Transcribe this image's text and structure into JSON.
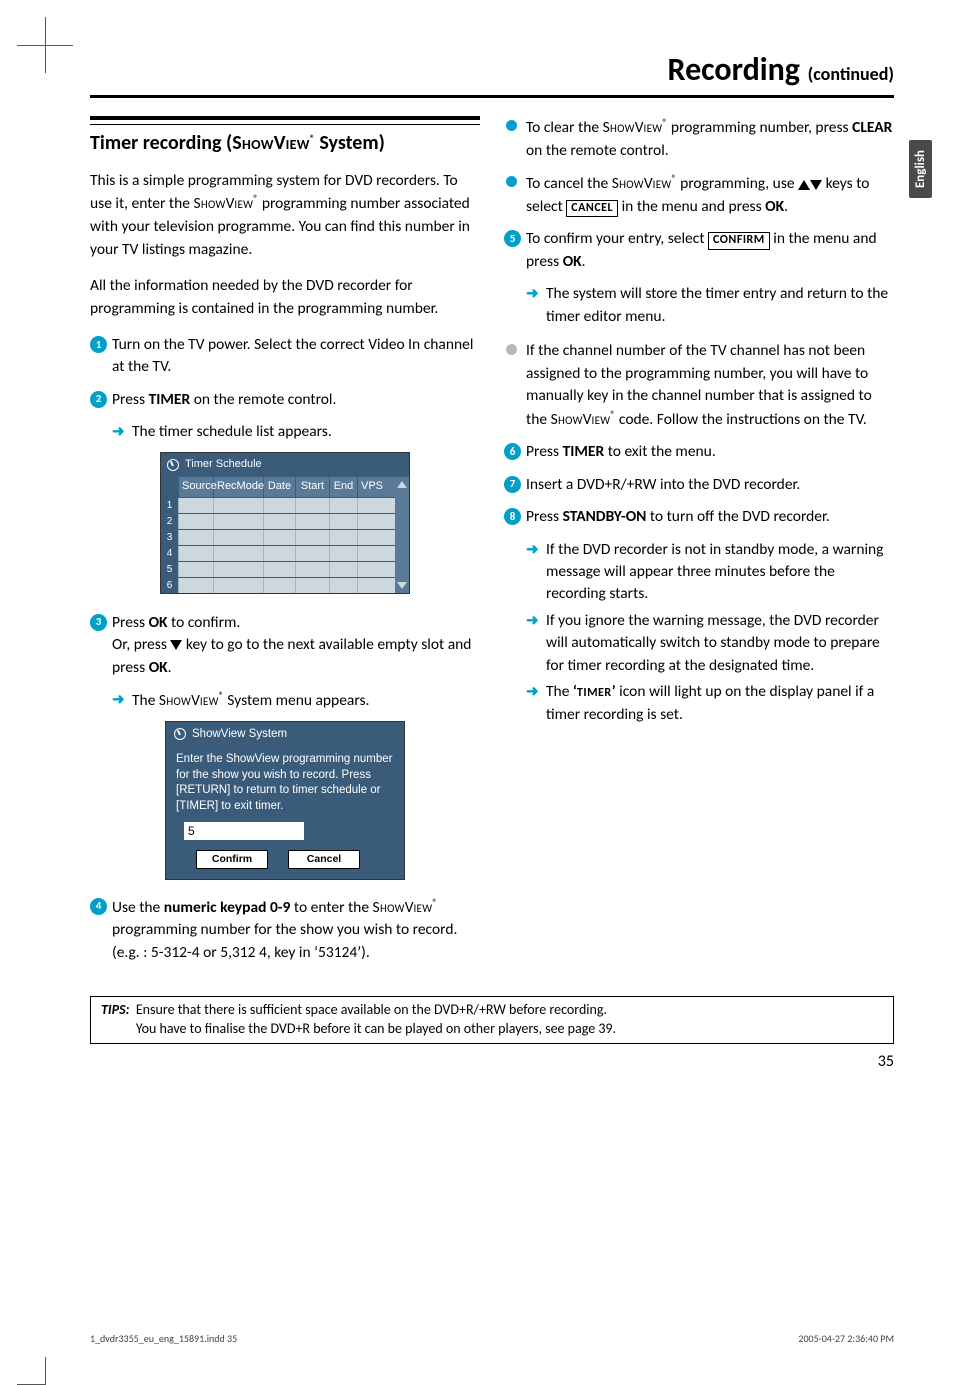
{
  "page": {
    "title": "Recording",
    "title_cont": "(continued)",
    "side_tab": "English",
    "page_number": "35"
  },
  "section_heading": {
    "line": "Timer recording (SHOWVIEW® System)"
  },
  "left": {
    "para1": "This is a simple programming system for DVD recorders. To use it, enter the SHOWVIEW® programming number associated with your television programme. You can find this number in your TV listings magazine.",
    "para2": "All the information needed by the DVD recorder for programming is contained in the programming number.",
    "step1": "Turn on the TV power. Select the correct Video In channel at the TV.",
    "step2": "Press TIMER on the remote control.",
    "step2_arrow": "The timer schedule list appears.",
    "schedule": {
      "title": "Timer Schedule",
      "headers": [
        "Source",
        "RecMode",
        "Date",
        "Start",
        "End",
        "VPS"
      ],
      "row_count": 6
    },
    "step3_a": "Press OK to confirm.",
    "step3_b": "Or, press ▼ key to go to the next available empty slot and press OK.",
    "step3_arrow": "The SHOWVIEW® System menu appears.",
    "svbox": {
      "title": "ShowView System",
      "body": "Enter the ShowView programming number for the show you wish to record. Press [RETURN] to return to timer schedule or [TIMER] to exit timer.",
      "input_value": "5",
      "btn_confirm": "Confirm",
      "btn_cancel": "Cancel"
    },
    "step4": "Use the numeric keypad 0-9 to enter the SHOWVIEW® programming number for the show you wish to record.",
    "step4_eg": "(e.g. : 5-312-4 or 5,312 4, key in ‘53124’)."
  },
  "right": {
    "bullet_clear": "To clear the SHOWVIEW® programming number, press CLEAR on the remote control.",
    "bullet_cancel_a": "To cancel the SHOWVIEW® programming, use ",
    "bullet_cancel_b": " keys to select ",
    "bullet_cancel_c": " in the menu and press OK.",
    "label_cancel": "CANCEL",
    "step5_a": "To confirm your entry, select ",
    "step5_b": " in the menu and press OK.",
    "label_confirm": "CONFIRM",
    "step5_arrow": "The system will store the timer entry and return to the timer editor menu.",
    "grey_bullet": "If the channel number of the TV channel has not been assigned to the programming number, you will have to manually key in the channel number that is assigned to the SHOWVIEW® code. Follow the instructions on the TV.",
    "step6": "Press TIMER to exit the menu.",
    "step7": "Insert a DVD+R/+RW into the DVD recorder.",
    "step8_a": "Press STANDBY-ON to turn off the DVD recorder.",
    "step8_arrow1": "If the DVD recorder is not in standby mode, a warning message will appear three minutes before the recording starts.",
    "step8_arrow2": "If you ignore the warning message, the DVD recorder will automatically switch to standby mode to prepare for timer recording at the designated time.",
    "step8_arrow3": "The ‘TIMER’ icon will light up on the display panel if a timer recording is set."
  },
  "tips": {
    "label": "TIPS:",
    "line1": "Ensure that there is sufficient space available on the DVD+R/+RW before recording.",
    "line2": "You have to finalise the DVD+R before it can be played on other players, see page 39."
  },
  "footer": {
    "left": "1_dvdr3355_eu_eng_15891.indd   35",
    "right": "2005-04-27   2:36:40 PM"
  }
}
